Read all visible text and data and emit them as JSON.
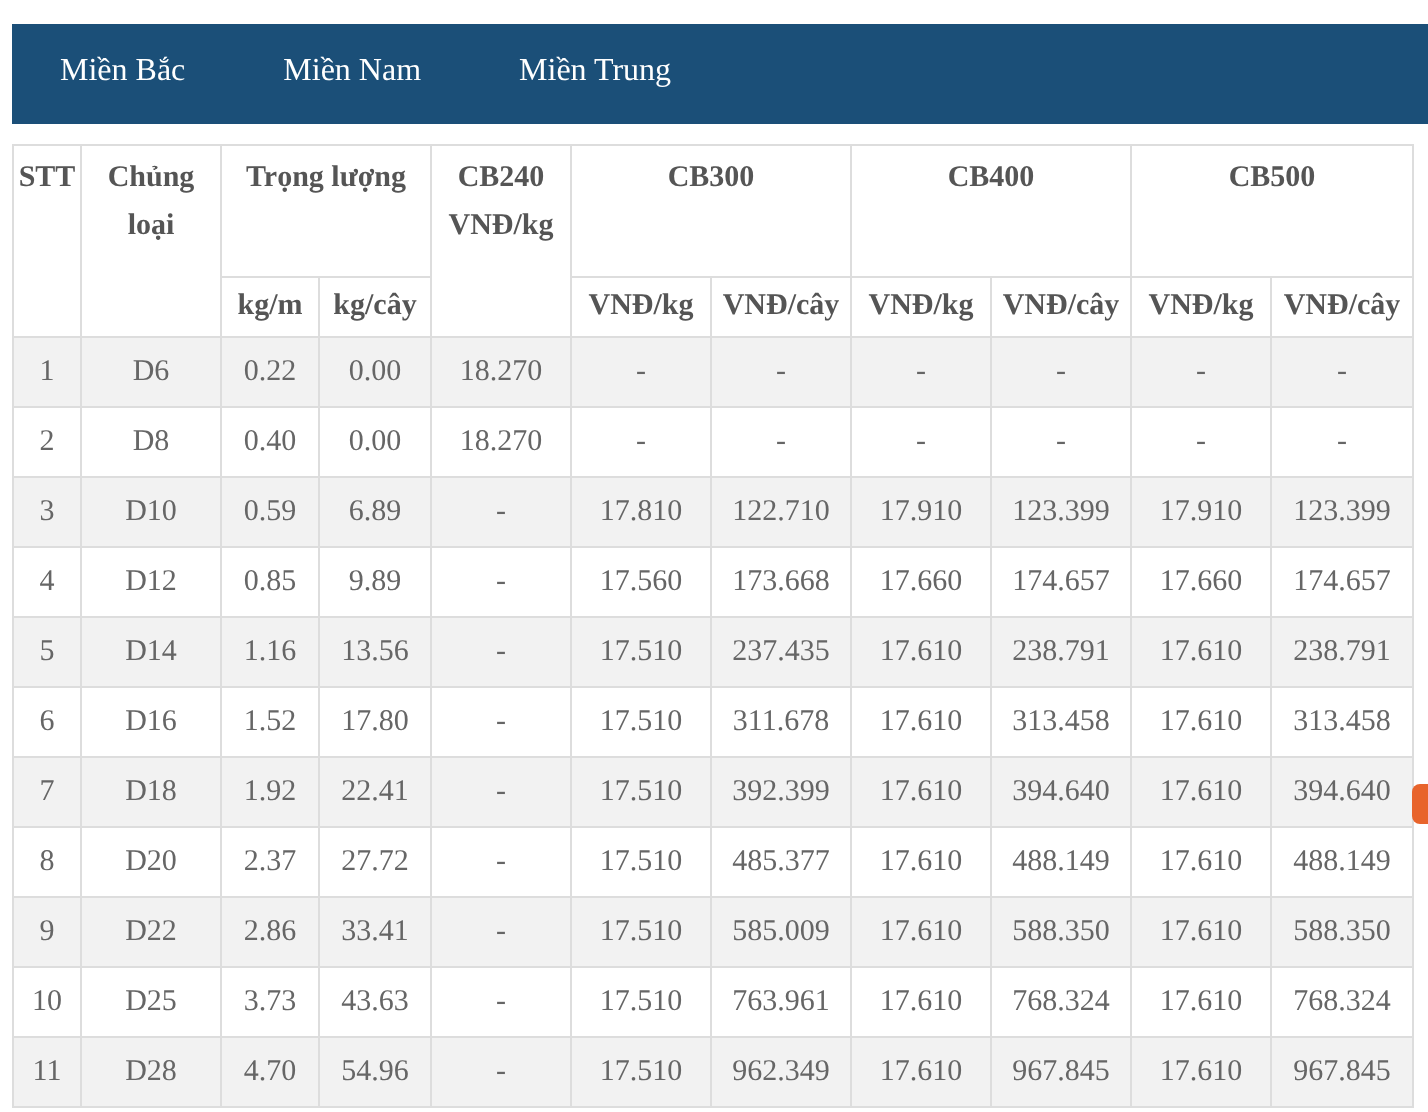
{
  "tabs": [
    {
      "label": "Miền Bắc",
      "selected": false
    },
    {
      "label": "Miền Nam",
      "selected": false
    },
    {
      "label": "Miền Trung",
      "selected": false
    }
  ],
  "table": {
    "header_top": [
      "STT",
      "Chủng loại",
      "Trọng lượng",
      "CB240 VNĐ/kg",
      "CB300",
      "CB400",
      "CB500"
    ],
    "header_sub": [
      "kg/m",
      "kg/cây",
      "VNĐ/kg",
      "VNĐ/cây",
      "VNĐ/kg",
      "VNĐ/cây",
      "VNĐ/kg",
      "VNĐ/cây"
    ],
    "rows": [
      [
        "1",
        "D6",
        "0.22",
        "0.00",
        "18.270",
        "-",
        "-",
        "-",
        "-",
        "-",
        "-"
      ],
      [
        "2",
        "D8",
        "0.40",
        "0.00",
        "18.270",
        "-",
        "-",
        "-",
        "-",
        "-",
        "-"
      ],
      [
        "3",
        "D10",
        "0.59",
        "6.89",
        "-",
        "17.810",
        "122.710",
        "17.910",
        "123.399",
        "17.910",
        "123.399"
      ],
      [
        "4",
        "D12",
        "0.85",
        "9.89",
        "-",
        "17.560",
        "173.668",
        "17.660",
        "174.657",
        "17.660",
        "174.657"
      ],
      [
        "5",
        "D14",
        "1.16",
        "13.56",
        "-",
        "17.510",
        "237.435",
        "17.610",
        "238.791",
        "17.610",
        "238.791"
      ],
      [
        "6",
        "D16",
        "1.52",
        "17.80",
        "-",
        "17.510",
        "311.678",
        "17.610",
        "313.458",
        "17.610",
        "313.458"
      ],
      [
        "7",
        "D18",
        "1.92",
        "22.41",
        "-",
        "17.510",
        "392.399",
        "17.610",
        "394.640",
        "17.610",
        "394.640"
      ],
      [
        "8",
        "D20",
        "2.37",
        "27.72",
        "-",
        "17.510",
        "485.377",
        "17.610",
        "488.149",
        "17.610",
        "488.149"
      ],
      [
        "9",
        "D22",
        "2.86",
        "33.41",
        "-",
        "17.510",
        "585.009",
        "17.610",
        "588.350",
        "17.610",
        "588.350"
      ],
      [
        "10",
        "D25",
        "3.73",
        "43.63",
        "-",
        "17.510",
        "763.961",
        "17.610",
        "768.324",
        "17.610",
        "768.324"
      ],
      [
        "11",
        "D28",
        "4.70",
        "54.96",
        "-",
        "17.510",
        "962.349",
        "17.610",
        "967.845",
        "17.610",
        "967.845"
      ]
    ]
  }
}
